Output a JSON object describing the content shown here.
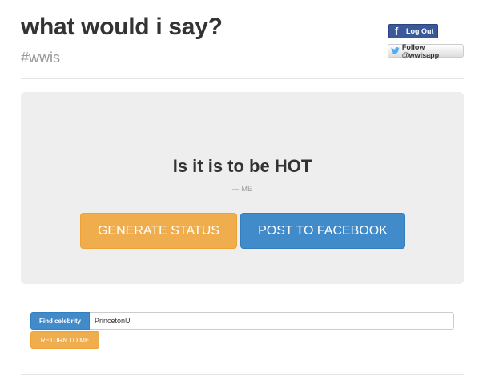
{
  "header": {
    "title": "what would i say?",
    "subtitle": "#wwis"
  },
  "social": {
    "facebook_logout_label": "Log Out",
    "facebook_icon_glyph": "f",
    "twitter_follow_label": "Follow @wwisapp"
  },
  "hero": {
    "quote": "Is it is to be HOT",
    "attribution": "— ME",
    "generate_label": "GENERATE STATUS",
    "post_label": "POST TO FACEBOOK"
  },
  "search": {
    "find_label": "Find celebrity",
    "input_value": "PrincetonU",
    "return_label": "RETURN TO ME"
  },
  "colors": {
    "primary_blue": "#428bca",
    "warning_orange": "#f0ad4e",
    "facebook_blue": "#3b5998",
    "hero_background": "#eeeeee"
  }
}
